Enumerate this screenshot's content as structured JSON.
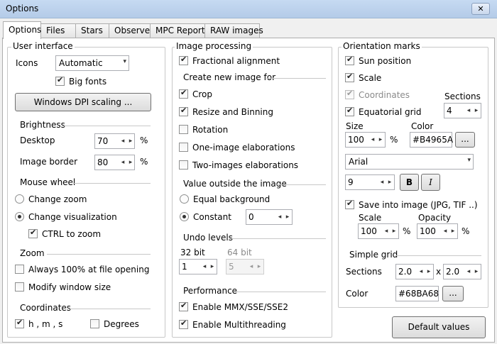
{
  "window": {
    "title": "Options",
    "close_glyph": "✕"
  },
  "tabs": [
    "Options",
    "Files",
    "Stars",
    "Observer",
    "MPC Report",
    "RAW images"
  ],
  "user_interface": {
    "title": "User interface",
    "icons_label": "Icons",
    "icons_value": "Automatic",
    "big_fonts": "Big fonts",
    "dpi_button": "Windows DPI scaling ...",
    "brightness": "Brightness",
    "desktop_label": "Desktop",
    "desktop_value": "70",
    "image_border_label": "Image border",
    "image_border_value": "80",
    "percent": "%",
    "mouse_wheel": "Mouse wheel",
    "change_zoom": "Change zoom",
    "change_visualization": "Change visualization",
    "ctrl_to_zoom": "CTRL to zoom",
    "zoom": "Zoom",
    "always_100": "Always 100% at file opening",
    "modify_window_size": "Modify window size",
    "coordinates": "Coordinates",
    "hms": "h , m , s",
    "degrees": "Degrees"
  },
  "image_processing": {
    "title": "Image processing",
    "fractional_alignment": "Fractional alignment",
    "create_new_image_for": "Create new image for",
    "crop": "Crop",
    "resize_binning": "Resize and Binning",
    "rotation": "Rotation",
    "one_image": "One-image elaborations",
    "two_images": "Two-images elaborations",
    "value_outside": "Value outside the image",
    "equal_background": "Equal background",
    "constant": "Constant",
    "constant_value": "0",
    "undo_levels": "Undo levels",
    "bit32": "32 bit",
    "bit32_value": "1",
    "bit64": "64 bit",
    "bit64_value": "5",
    "performance": "Performance",
    "mmx": "Enable MMX/SSE/SSE2",
    "multithreading": "Enable Multithreading"
  },
  "orientation_marks": {
    "title": "Orientation marks",
    "sun_position": "Sun position",
    "scale": "Scale",
    "coordinates": "Coordinates",
    "sections_label": "Sections",
    "sections_value": "4",
    "equatorial_grid": "Equatorial grid",
    "size_label": "Size",
    "size_value": "100",
    "percent": "%",
    "color_label": "Color",
    "color_value": "#B4965A",
    "browse": "...",
    "font_value": "Arial",
    "font_size": "9",
    "bold": "B",
    "italic": "I",
    "save_into_image": "Save into image (JPG, TIF ..)",
    "scale_label": "Scale",
    "scale_value": "100",
    "opacity_label": "Opacity",
    "opacity_value": "100",
    "simple_grid": "Simple grid",
    "sg_sections_label": "Sections",
    "sg_x": "2.0",
    "times": "x",
    "sg_y": "2.0",
    "sg_color_label": "Color",
    "sg_color_value": "#68BA68"
  },
  "footer": {
    "default_values": "Default values"
  },
  "icons": {
    "up": "◂",
    "down": "▸",
    "drop": "▾"
  },
  "colors": {
    "title_bar": "#c6daf2",
    "panel": "#ffffff",
    "border": "#adadad"
  }
}
